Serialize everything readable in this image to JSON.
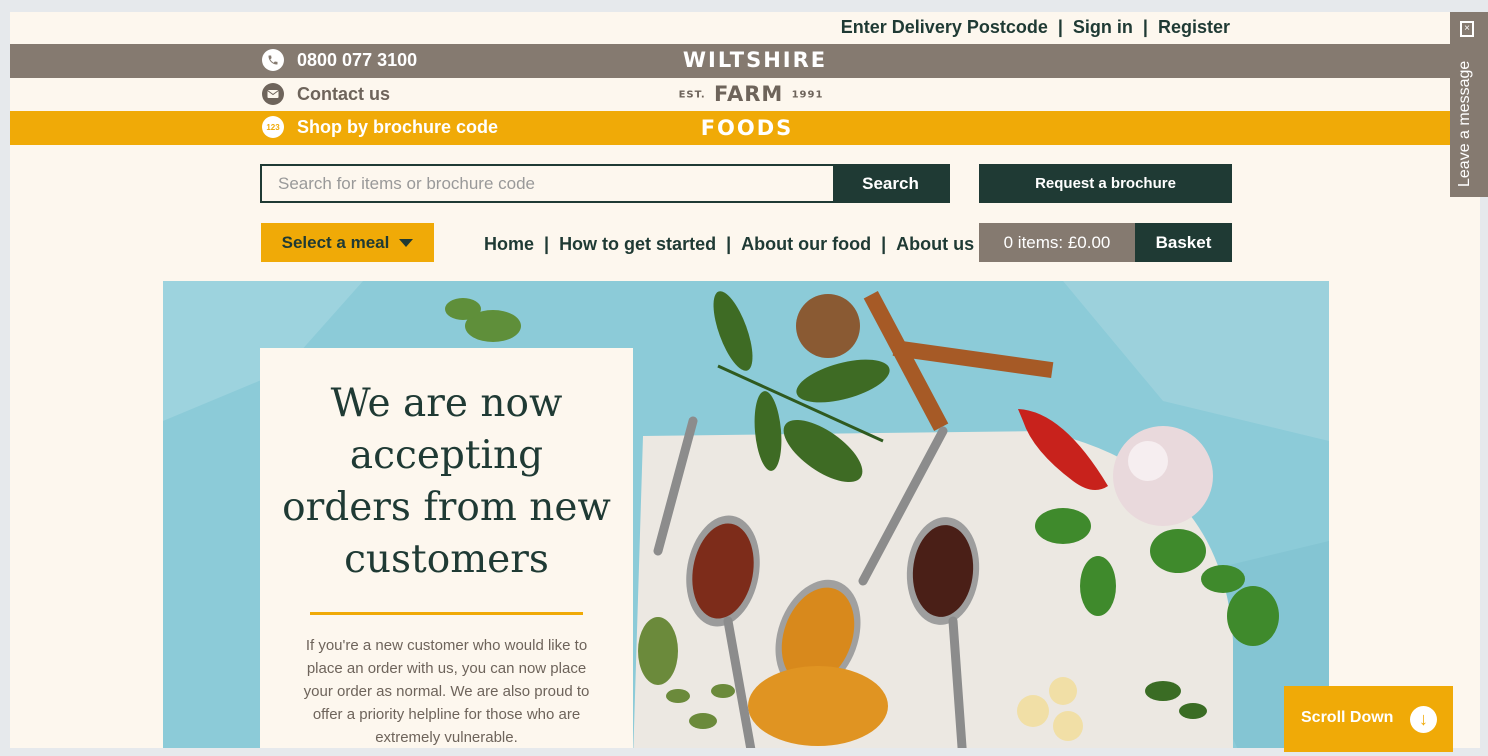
{
  "top_links": {
    "postcode": "Enter Delivery Postcode",
    "sep1": "|",
    "sign_in": "Sign in",
    "sep2": "|",
    "register": "Register"
  },
  "header": {
    "phone": "0800 077 3100",
    "contact": "Contact us",
    "brochure_code": "Shop by brochure code",
    "brochure_code_icon_text": "123",
    "logo": {
      "line1": "WILTSHIRE",
      "est": "EST.",
      "line2": "FARM",
      "year": "1991",
      "line3": "FOODS"
    }
  },
  "search": {
    "placeholder": "Search for items or brochure code",
    "button": "Search"
  },
  "request_brochure": "Request a brochure",
  "meal_select": "Select a meal",
  "nav": {
    "items": [
      "Home",
      "How to get started",
      "About our food",
      "About us"
    ],
    "sep": "|"
  },
  "basket": {
    "summary": "0 items: £0.00",
    "button": "Basket"
  },
  "hero": {
    "title": "We are now accepting orders from new customers",
    "text": "If you're a new customer who would like to place an order with us, you can now place your order as normal. We are also proud to offer a priority helpline for those who are extremely vulnerable."
  },
  "side_tab": {
    "label": "Leave a message"
  },
  "scroll_down": "Scroll Down",
  "colors": {
    "dark_green": "#1f3a34",
    "taupe": "#857a70",
    "mustard": "#f0aa07",
    "cream": "#fdf7ee",
    "sky": "#8ccbd8"
  }
}
